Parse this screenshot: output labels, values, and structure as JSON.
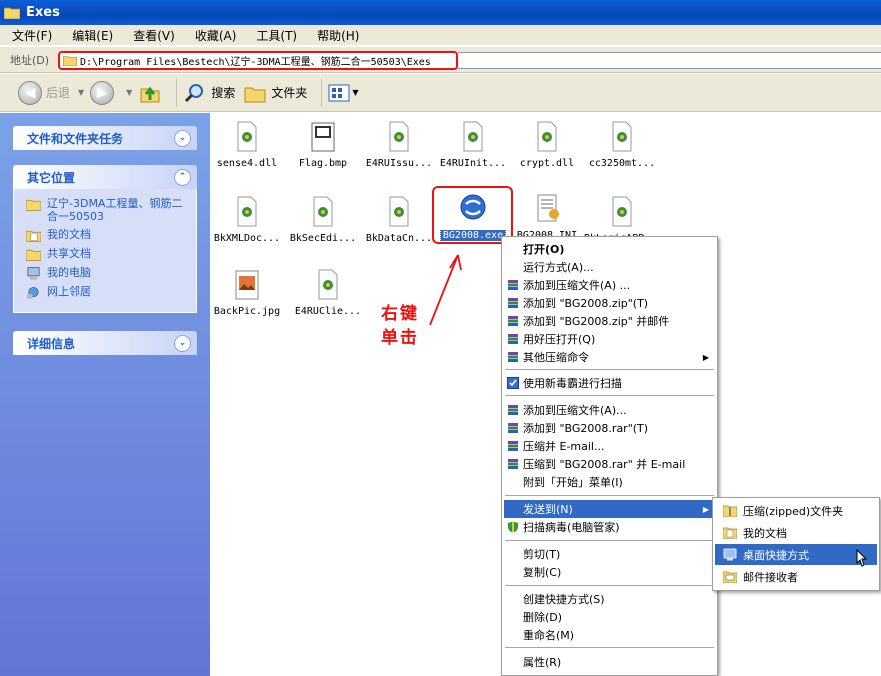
{
  "window": {
    "title": "Exes"
  },
  "menubar": [
    "文件(F)",
    "编辑(E)",
    "查看(V)",
    "收藏(A)",
    "工具(T)",
    "帮助(H)"
  ],
  "address": {
    "label": "地址(D)",
    "path": "D:\\Program Files\\Bestech\\辽宁-3DMA工程量、钢筋二合一50503\\Exes"
  },
  "toolbar": {
    "back": "后退",
    "search": "搜索",
    "folders": "文件夹"
  },
  "leftpane": {
    "file_tasks": {
      "title": "文件和文件夹任务"
    },
    "other_places": {
      "title": "其它位置",
      "items": [
        "辽宁-3DMA工程量、钢筋二合一50503",
        "我的文档",
        "共享文档",
        "我的电脑",
        "网上邻居"
      ]
    },
    "details": {
      "title": "详细信息"
    }
  },
  "files": [
    "sense4.dll",
    "Flag.bmp",
    "E4RUIssu...",
    "E4RUInit...",
    "crypt.dll",
    "cc3250mt...",
    "BkXMLDoc...",
    "BkSecEdi...",
    "BkDataCn...",
    "BG2008.exe",
    "BG2008.INI",
    "BkLogicAPP...",
    "BackPic.jpg",
    "E4RUClie..."
  ],
  "annotation": {
    "line1": "右键",
    "line2": "单击"
  },
  "context_menu": {
    "open": "打开(O)",
    "run_as": "运行方式(A)...",
    "add_archive": "添加到压缩文件(A) ...",
    "add_zip": "添加到 \"BG2008.zip\"(T)",
    "add_zip_mail": "添加到 \"BG2008.zip\" 并邮件",
    "open_haozip": "用好压打开(Q)",
    "other_compress": "其他压缩命令",
    "scan_xdb": "使用新毒霸进行扫描",
    "add_archive2": "添加到压缩文件(A)...",
    "add_rar": "添加到 \"BG2008.rar\"(T)",
    "compress_email": "压缩并 E-mail...",
    "compress_rar_email": "压缩到 \"BG2008.rar\" 并 E-mail",
    "pin_start": "附到「开始」菜单(I)",
    "send_to": "发送到(N)",
    "scan_virus": "扫描病毒(电脑管家)",
    "cut": "剪切(T)",
    "copy": "复制(C)",
    "create_shortcut": "创建快捷方式(S)",
    "delete": "删除(D)",
    "rename": "重命名(M)",
    "properties": "属性(R)"
  },
  "send_to_menu": [
    "压缩(zipped)文件夹",
    "我的文档",
    "桌面快捷方式",
    "邮件接收者"
  ],
  "colors": {
    "highlight": "#316ac5",
    "annotation": "#ee1111",
    "left_pane": "#6f8fde",
    "titlebar": "#0a50c8"
  }
}
